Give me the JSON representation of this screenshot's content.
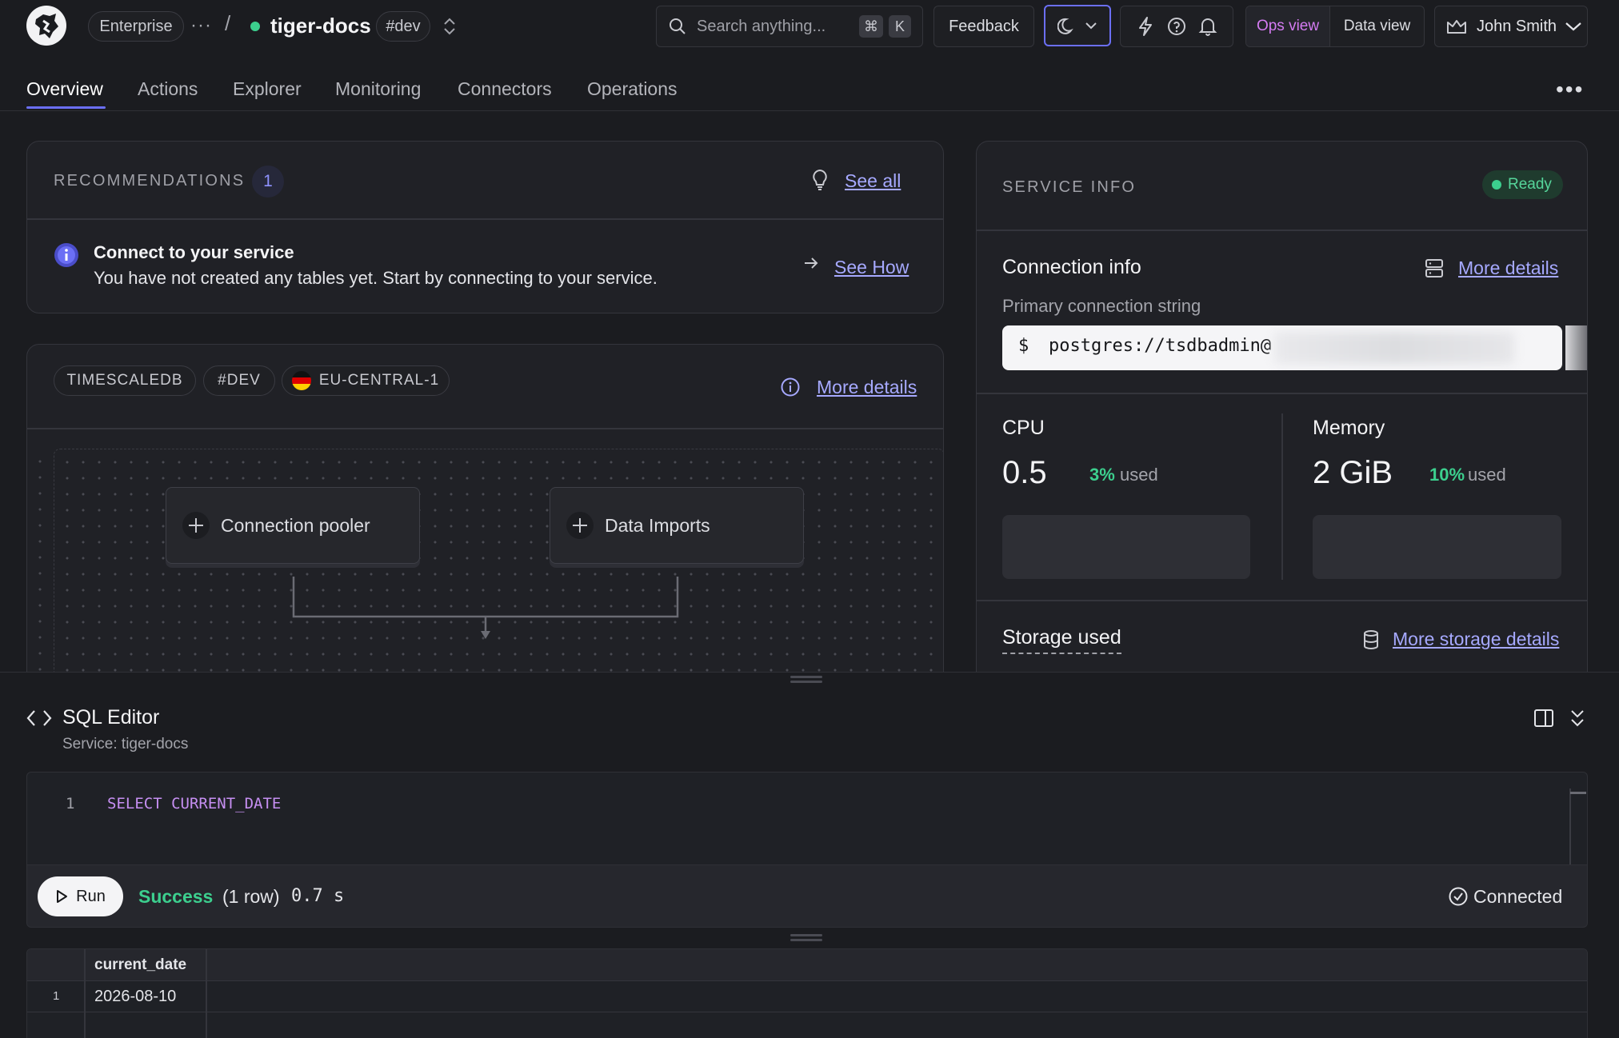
{
  "header": {
    "org_label": "Enterprise",
    "more_glyph": "···",
    "separator": "/",
    "service_name": "tiger-docs",
    "service_status_color": "#3ccf8e",
    "env_tag": "#dev",
    "search_placeholder": "Search anything...",
    "shortcut_cmd": "⌘",
    "shortcut_key": "K",
    "feedback_label": "Feedback",
    "view_ops": "Ops view",
    "view_data": "Data view",
    "user_name": "John Smith",
    "accent": "#6b6ff5"
  },
  "tabs": [
    {
      "label": "Overview"
    },
    {
      "label": "Actions"
    },
    {
      "label": "Explorer"
    },
    {
      "label": "Monitoring"
    },
    {
      "label": "Connectors"
    },
    {
      "label": "Operations"
    }
  ],
  "recommendations": {
    "title": "RECOMMENDATIONS",
    "count": "1",
    "see_all": "See all",
    "item_title": "Connect to your service",
    "item_desc": "You have not created any tables yet. Start by connecting to your service.",
    "see_how": "See How"
  },
  "service_card": {
    "tags": [
      "TIMESCALEDB",
      "#DEV",
      "EU-CENTRAL-1"
    ],
    "more_details": "More details",
    "nodes": [
      {
        "label": "Connection pooler"
      },
      {
        "label": "Data Imports"
      }
    ]
  },
  "service_info": {
    "title": "SERVICE INFO",
    "status": "Ready",
    "connection_title": "Connection info",
    "more_details": "More details",
    "primary_label": "Primary connection string",
    "prompt": "$",
    "conn_string": "postgres://tsdbadmin@",
    "cpu_label": "CPU",
    "cpu_value": "0.5",
    "cpu_pct": "3%",
    "cpu_used": "used",
    "memory_label": "Memory",
    "memory_value": "2 GiB",
    "memory_pct": "10%",
    "memory_used": "used",
    "storage_label": "Storage used",
    "storage_details": "More storage details"
  },
  "sql_editor": {
    "title": "SQL Editor",
    "service_line": "Service: tiger-docs",
    "line_number": "1",
    "query": "SELECT CURRENT_DATE",
    "run_label": "Run",
    "status": "Success",
    "rows": "(1 row)",
    "time": "0.7 s",
    "connection": "Connected"
  },
  "results": {
    "columns": [
      "current_date"
    ],
    "rows": [
      {
        "index": "1",
        "values": [
          "2026-08-10"
        ]
      }
    ]
  }
}
